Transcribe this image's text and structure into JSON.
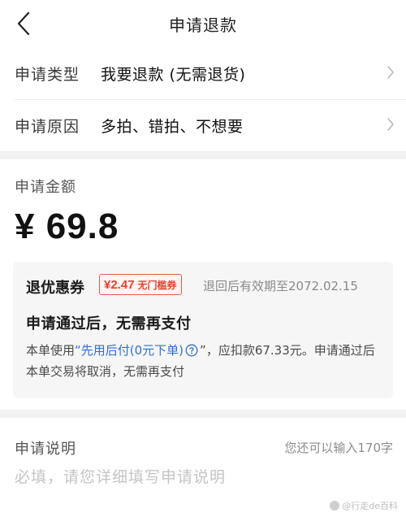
{
  "header": {
    "title": "申请退款"
  },
  "form": {
    "type": {
      "label": "申请类型",
      "value": "我要退款 (无需退货)"
    },
    "reason": {
      "label": "申请原因",
      "value": "多拍、错拍、不想要"
    }
  },
  "amount": {
    "label": "申请金额",
    "value": "¥ 69.8",
    "coupon": {
      "title": "退优惠券",
      "amount": "¥2.47",
      "desc": "无门槛券",
      "expire": "退回后有效期至2072.02.15"
    },
    "approval": {
      "title": "申请通过后，无需再支付",
      "text_before": "本单使用",
      "link_text": "“先用后付(0元下单)",
      "text_after": "”，应扣款67.33元。申请通过后本单交易将取消，无需再支付"
    }
  },
  "description": {
    "label": "申请说明",
    "counter": "您还可以输入170字",
    "placeholder": "必填，请您详细填写申请说明"
  },
  "watermark": "@行走de百科",
  "colors": {
    "accent_red": "#e8402f",
    "link_blue": "#2f6fd6",
    "page_bg": "#f2f2f2"
  },
  "icons": {
    "back": "chevron-left-icon",
    "row_arrow": "chevron-right-icon",
    "help": "question-circle-icon"
  }
}
